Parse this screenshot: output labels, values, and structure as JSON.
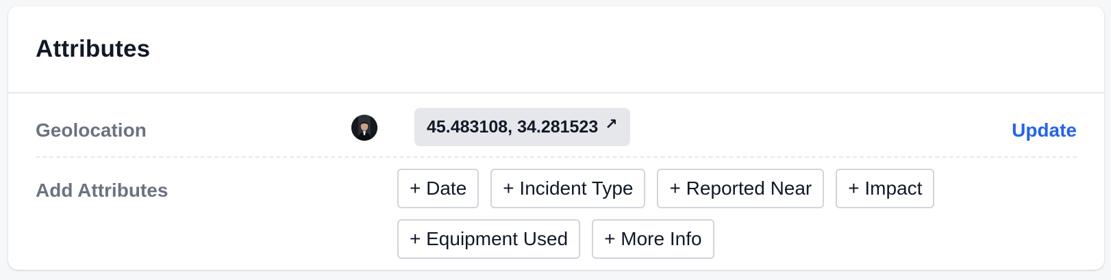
{
  "card": {
    "title": "Attributes"
  },
  "geolocation": {
    "label": "Geolocation",
    "avatar_icon": "user-avatar",
    "coordinates": "45.483108, 34.281523",
    "link_icon": "↗",
    "update_label": "Update"
  },
  "add_attributes": {
    "label": "Add Attributes",
    "buttons": [
      "+ Date",
      "+ Incident Type",
      "+ Reported Near",
      "+ Impact",
      "+ Equipment Used",
      "+ More Info"
    ]
  },
  "colors": {
    "accent": "#2563eb",
    "label_gray": "#6b7280",
    "pill_bg": "#e5e7eb"
  }
}
